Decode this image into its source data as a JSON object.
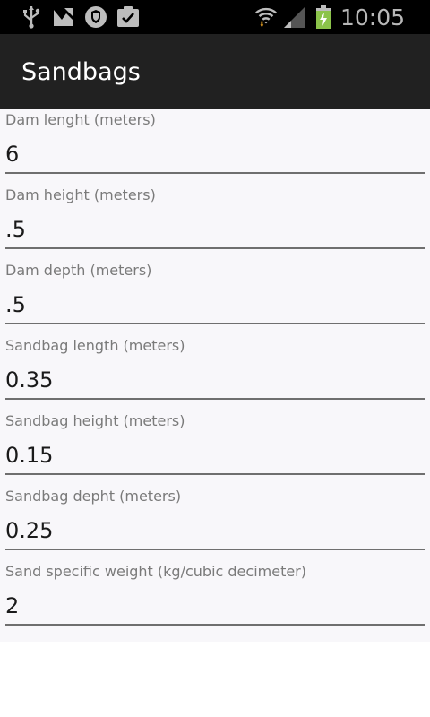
{
  "status_bar": {
    "time": "10:05",
    "left_icons": [
      "usb-icon",
      "transfer-icon",
      "shield-icon",
      "clipboard-check-icon"
    ],
    "right_icons": [
      "wifi-icon",
      "signal-icon",
      "battery-charging-icon"
    ]
  },
  "app_bar": {
    "title": "Sandbags"
  },
  "fields": [
    {
      "label": "Dam lenght (meters)",
      "value": "6"
    },
    {
      "label": "Dam height (meters)",
      "value": ".5"
    },
    {
      "label": "Dam depth (meters)",
      "value": ".5"
    },
    {
      "label": "Sandbag length (meters)",
      "value": "0.35"
    },
    {
      "label": "Sandbag height (meters)",
      "value": "0.15"
    },
    {
      "label": "Sandbag depht (meters)",
      "value": "0.25"
    },
    {
      "label": "Sand specific weight (kg/cubic decimeter)",
      "value": "2"
    }
  ]
}
